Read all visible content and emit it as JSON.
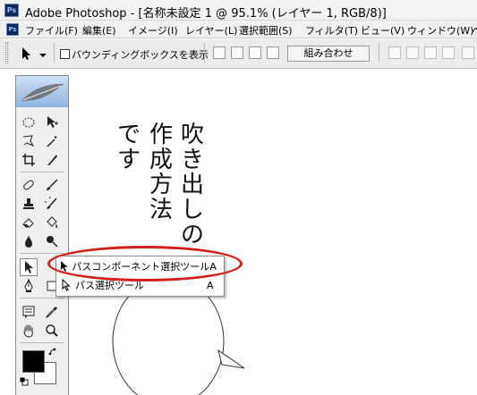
{
  "window": {
    "title": "Adobe Photoshop - [名称未設定 1 @ 95.1% (レイヤー 1, RGB/8)]"
  },
  "menu": [
    {
      "label": "ファイル(F)"
    },
    {
      "label": "編集(E)"
    },
    {
      "label": "イメージ(I)"
    },
    {
      "label": "レイヤー(L)"
    },
    {
      "label": "選択範囲(S)"
    },
    {
      "label": "フィルタ(T)"
    },
    {
      "label": "ビュー(V)"
    },
    {
      "label": "ウィンドウ(W)"
    },
    {
      "label": "ヘ"
    }
  ],
  "options": {
    "bbox_label": "バウンディングボックスを表示",
    "bbox_checked": false,
    "combine_label": "組み合わせ"
  },
  "canvas": {
    "columns": [
      "吹き出しの",
      "作成方法",
      "です"
    ]
  },
  "flyout": {
    "items": [
      {
        "label": "パスコンポーネント選択ツール",
        "shortcut": "A",
        "icon": "solid-arrow-icon"
      },
      {
        "label": "パス選択ツール",
        "shortcut": "A",
        "icon": "hollow-arrow-icon"
      }
    ]
  },
  "colors": {
    "foreground": "#000000",
    "background": "#ffffff",
    "highlight": "#d0201b"
  },
  "toolbox": {
    "tools": [
      "marquee-tool",
      "move-tool",
      "lasso-tool",
      "magic-wand-tool",
      "crop-tool",
      "slice-tool",
      "healing-brush-tool",
      "brush-tool",
      "clone-stamp-tool",
      "history-brush-tool",
      "eraser-tool",
      "paint-bucket-tool",
      "blur-tool",
      "dodge-tool",
      "path-selection-tool",
      "type-tool",
      "pen-tool",
      "shape-tool",
      "notes-tool",
      "eyedropper-tool",
      "hand-tool",
      "zoom-tool"
    ]
  }
}
